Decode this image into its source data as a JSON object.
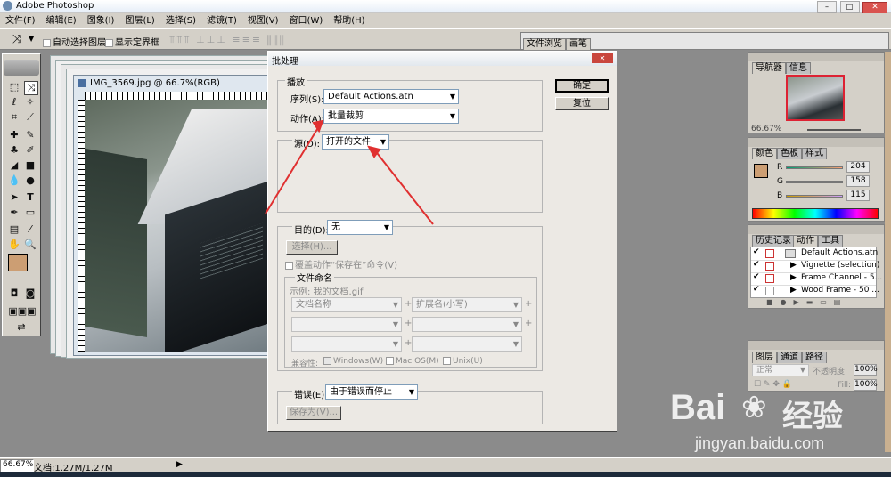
{
  "app": {
    "title": "Adobe Photoshop"
  },
  "menu": [
    "文件(F)",
    "编辑(E)",
    "图象(I)",
    "图层(L)",
    "选择(S)",
    "滤镜(T)",
    "视图(V)",
    "窗口(W)",
    "帮助(H)"
  ],
  "options_bar": {
    "auto_select_layer": "自动选择图层",
    "show_bounds": "显示定界框",
    "tabs": [
      "文件浏览",
      "画笔"
    ]
  },
  "document": {
    "title": "IMG_3569.jpg @ 66.7%(RGB)"
  },
  "dialog": {
    "title": "批处理",
    "play_group": "播放",
    "set_label": "序列(S):",
    "set_value": "Default Actions.atn",
    "action_label": "动作(A):",
    "action_value": "批量裁剪",
    "source_label": "源(O):",
    "source_value": "打开的文件",
    "dest_label": "目的(D):",
    "dest_value": "无",
    "choose_button": "选择(H)...",
    "override_save": "覆盖动作“保存在”命令(V)",
    "file_naming": "文件命名",
    "example": "示例: 我的文档.gif",
    "name_field_1": "文档名称",
    "name_field_2": "扩展名(小写)",
    "compat_label": "兼容性:",
    "compat_windows": "Windows(W)",
    "compat_mac": "Mac OS(M)",
    "compat_unix": "Unix(U)",
    "errors_label": "错误(E):",
    "errors_value": "由于错误而停止",
    "save_as_button": "保存为(V)...",
    "ok_button": "确定",
    "reset_button": "复位"
  },
  "navigator": {
    "tabs": [
      "导航器",
      "信息"
    ],
    "zoom": "66.67%"
  },
  "color": {
    "tabs": [
      "颜色",
      "色板",
      "样式"
    ],
    "r_label": "R",
    "g_label": "G",
    "b_label": "B",
    "r": 204,
    "g": 158,
    "b": 115,
    "swatch": "#cc9e73"
  },
  "actions": {
    "tabs": [
      "历史记录",
      "动作",
      "工具"
    ],
    "items": [
      "Default Actions.atn",
      "Vignette (selection)",
      "Frame Channel - 5...",
      "Wood Frame - 50 ..."
    ]
  },
  "layers": {
    "tabs": [
      "图层",
      "通道",
      "路径"
    ],
    "mode": "正常",
    "opacity_label": "不透明度:",
    "opacity": "100%",
    "fill_label": "Fill:",
    "fill": "100%"
  },
  "status": {
    "zoom": "66.67%",
    "doc": "文档:1.27M/1.27M"
  },
  "watermark": {
    "line1": "Bai",
    "line2": "经验",
    "url": "jingyan.baidu.com"
  }
}
